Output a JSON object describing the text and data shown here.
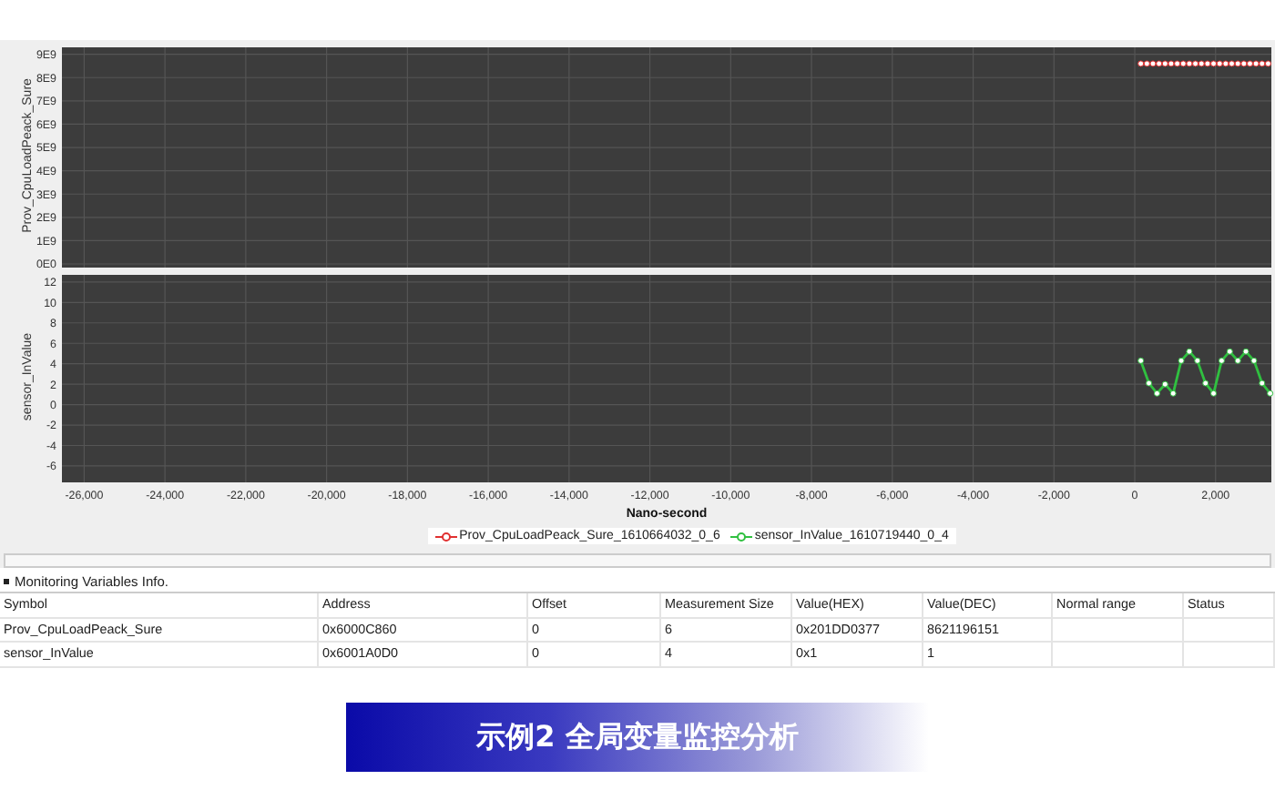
{
  "charts": [
    {
      "chart_data": {
        "type": "line",
        "ylabel": "Prov_CpuLoadPeack_Sure",
        "xlim": [
          -26550,
          3380
        ],
        "ylim": [
          0,
          9300000000
        ],
        "yticks": [
          {
            "value": 0,
            "label": "0E0"
          },
          {
            "value": 1000000000,
            "label": "1E9"
          },
          {
            "value": 2000000000,
            "label": "2E9"
          },
          {
            "value": 3000000000,
            "label": "3E9"
          },
          {
            "value": 4000000000,
            "label": "4E9"
          },
          {
            "value": 5000000000,
            "label": "5E9"
          },
          {
            "value": 6000000000,
            "label": "6E9"
          },
          {
            "value": 7000000000,
            "label": "7E9"
          },
          {
            "value": 8000000000,
            "label": "8E9"
          },
          {
            "value": 9000000000,
            "label": "9E9"
          }
        ],
        "x": [
          150,
          300,
          450,
          600,
          750,
          900,
          1050,
          1200,
          1350,
          1500,
          1650,
          1800,
          1950,
          2100,
          2250,
          2400,
          2550,
          2700,
          2850,
          3000,
          3150,
          3300
        ],
        "grid": true,
        "series": [
          {
            "name": "Prov_CpuLoadPeack_Sure_1610664032_0_6",
            "color": "#e03030",
            "marker": "circle",
            "values": [
              8600000000,
              8600000000,
              8600000000,
              8600000000,
              8600000000,
              8600000000,
              8600000000,
              8600000000,
              8600000000,
              8600000000,
              8600000000,
              8600000000,
              8600000000,
              8600000000,
              8600000000,
              8600000000,
              8600000000,
              8600000000,
              8600000000,
              8600000000,
              8600000000,
              8600000000
            ]
          }
        ]
      }
    },
    {
      "chart_data": {
        "type": "line",
        "ylabel": "sensor_InValue",
        "xlabel": "Nano-second",
        "xlim": [
          -26550,
          3380
        ],
        "ylim": [
          -7.25,
          12.7
        ],
        "yticks": [
          -6,
          -4,
          -2,
          0,
          2,
          4,
          6,
          8,
          10,
          12
        ],
        "xticks": [
          {
            "value": -26000,
            "label": "-26,000"
          },
          {
            "value": -24000,
            "label": "-24,000"
          },
          {
            "value": -22000,
            "label": "-22,000"
          },
          {
            "value": -20000,
            "label": "-20,000"
          },
          {
            "value": -18000,
            "label": "-18,000"
          },
          {
            "value": -16000,
            "label": "-16,000"
          },
          {
            "value": -14000,
            "label": "-14,000"
          },
          {
            "value": -12000,
            "label": "-12,000"
          },
          {
            "value": -10000,
            "label": "-10,000"
          },
          {
            "value": -8000,
            "label": "-8,000"
          },
          {
            "value": -6000,
            "label": "-6,000"
          },
          {
            "value": -4000,
            "label": "-4,000"
          },
          {
            "value": -2000,
            "label": "-2,000"
          },
          {
            "value": 0,
            "label": "0"
          },
          {
            "value": 2000,
            "label": "2,000"
          }
        ],
        "x": [
          150,
          350,
          550,
          750,
          950,
          1150,
          1350,
          1550,
          1750,
          1950,
          2150,
          2350,
          2550,
          2750,
          2950,
          3150,
          3350
        ],
        "grid": true,
        "series": [
          {
            "name": "sensor_InValue_1610719440_0_4",
            "color": "#30c040",
            "marker": "circle",
            "values": [
              4.3,
              2.1,
              1.1,
              2,
              1.1,
              4.3,
              5.2,
              4.3,
              2.1,
              1.1,
              4.3,
              5.2,
              4.3,
              5.2,
              4.3,
              2.1,
              1.1
            ]
          }
        ]
      }
    }
  ],
  "panel_title": "Monitoring Variables Info.",
  "table": {
    "columns": [
      "Symbol",
      "Address",
      "Offset",
      "Measurement Size",
      "Value(HEX)",
      "Value(DEC)",
      "Normal range",
      "Status"
    ],
    "rows": [
      [
        "Prov_CpuLoadPeack_Sure",
        "0x6000C860",
        "0",
        "6",
        "0x201DD0377",
        "8621196151",
        "",
        ""
      ],
      [
        "sensor_InValue",
        "0x6001A0D0",
        "0",
        "4",
        "0x1",
        "1",
        "",
        ""
      ]
    ]
  },
  "caption": "示例2 全局变量监控分析"
}
